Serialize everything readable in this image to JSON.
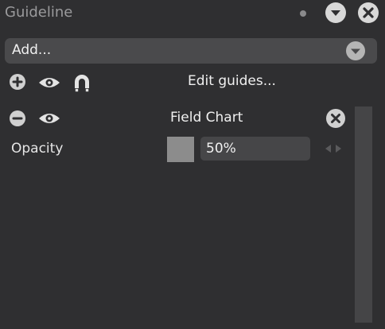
{
  "panel": {
    "title": "Guideline"
  },
  "add_dropdown": {
    "selected": "Add..."
  },
  "toolbar": {
    "edit_guides_label": "Edit guides..."
  },
  "layers": [
    {
      "name": "Field Chart",
      "opacity_label": "Opacity",
      "opacity_value": "50%",
      "swatch_color": "#8c8c8c"
    }
  ],
  "colors": {
    "background": "#2f2f31",
    "dropdown": "#4a4a4c",
    "input": "#464648",
    "icon": "#d0d0d0",
    "text": "#f0f0f0"
  }
}
